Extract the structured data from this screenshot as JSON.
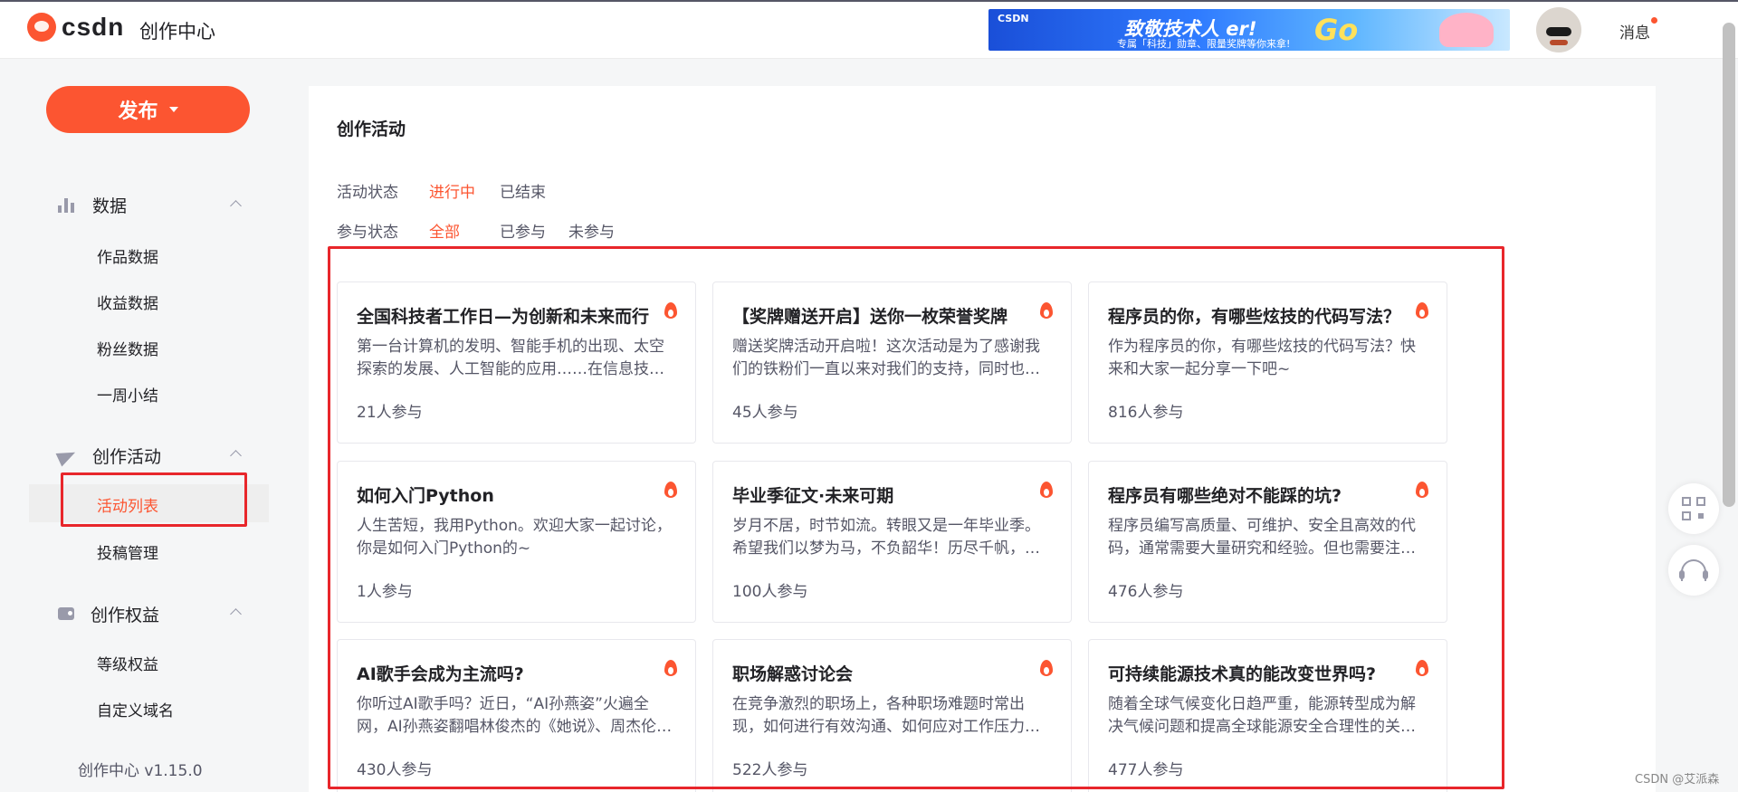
{
  "header": {
    "logo_text": "csdn",
    "title": "创作中心",
    "banner": {
      "tag": "CSDN",
      "title": "致敬技术人 er!",
      "subtitle": "专属「科技」勋章、限量奖牌等你来拿!",
      "cta": "Go"
    },
    "messages_label": "消息"
  },
  "sidebar": {
    "publish_label": "发布",
    "groups": [
      {
        "label": "数据",
        "icon": "bar-chart-icon",
        "items": [
          "作品数据",
          "收益数据",
          "粉丝数据",
          "一周小结"
        ]
      },
      {
        "label": "创作活动",
        "icon": "paper-plane-icon",
        "items": [
          "活动列表",
          "投稿管理"
        ]
      },
      {
        "label": "创作权益",
        "icon": "wallet-icon",
        "items": [
          "等级权益",
          "自定义域名"
        ]
      }
    ],
    "active_item": "活动列表",
    "version": "创作中心 v1.15.0"
  },
  "main": {
    "title": "创作活动",
    "filters": {
      "status": {
        "label": "活动状态",
        "options": [
          "进行中",
          "已结束"
        ],
        "selected": "进行中"
      },
      "participation": {
        "label": "参与状态",
        "options": [
          "全部",
          "已参与",
          "未参与"
        ],
        "selected": "全部"
      }
    },
    "cards": [
      {
        "title": "全国科技者工作日—为创新和未来而行",
        "desc": "第一台计算机的发明、智能手机的出现、太空探索的发展、人工智能的应用……在信息技术的发展历程中",
        "count": "21人参与"
      },
      {
        "title": "【奖牌赠送开启】送你一枚荣誉奖牌",
        "desc": "赠送奖牌活动开启啦！这次活动是为了感谢我们的铁粉们一直以来对我们的支持，同时也欢迎更多新朋友",
        "count": "45人参与"
      },
      {
        "title": "程序员的你，有哪些炫技的代码写法？",
        "desc": "作为程序员的你，有哪些炫技的代码写法？快来和大家一起分享一下吧~",
        "count": "816人参与"
      },
      {
        "title": "如何入门Python",
        "desc": "人生苦短，我用Python。欢迎大家一起讨论，你是如何入门Python的~",
        "count": "1人参与"
      },
      {
        "title": "毕业季征文·未来可期",
        "desc": "岁月不居，时节如流。转眼又是一年毕业季。希望我们以梦为马，不负韶华！历尽千帆，归来仍是少年",
        "count": "100人参与"
      },
      {
        "title": "程序员有哪些绝对不能踩的坑?",
        "desc": "程序员编写高质量、可维护、安全且高效的代码，通常需要大量研究和经验。但也需要注意避免踩坑",
        "count": "476人参与"
      },
      {
        "title": "AI歌手会成为主流吗?",
        "desc": "你听过AI歌手吗？近日，“AI孙燕姿”火遍全网，AI孙燕姿翻唱林俊杰的《她说》、周杰伦的歌曲",
        "count": "430人参与"
      },
      {
        "title": "职场解惑讨论会",
        "desc": "在竞争激烈的职场上，各种职场难题时常出现，如何进行有效沟通、如何应对工作压力、如何平衡生活",
        "count": "522人参与"
      },
      {
        "title": "可持续能源技术真的能改变世界吗?",
        "desc": "随着全球气候变化日趋严重，能源转型成为解决气候问题和提高全球能源安全合理性的关键途径",
        "count": "477人参与"
      }
    ]
  },
  "watermark": "CSDN @艾派森",
  "colors": {
    "brand": "#fc5531",
    "highlight_outline": "#e8262b"
  }
}
